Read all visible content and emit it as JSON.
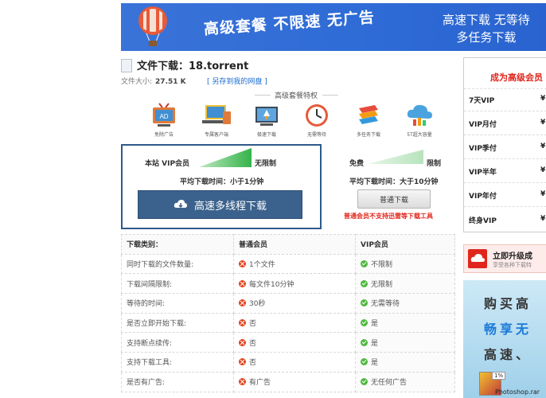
{
  "banner": {
    "promo_text": "高级套餐 不限速 无广告",
    "right_line1": "高速下载 无等待",
    "right_line2": "多任务下载"
  },
  "file": {
    "title": "文件下载：18.torrent",
    "size_label": "文件大小:",
    "size_value": "27.51 K",
    "save_link": "[ 另存到我的网盘 ]"
  },
  "features": {
    "title": "高级套餐特权",
    "items": [
      {
        "label": "免除广告",
        "icon": "tv-ad-icon"
      },
      {
        "label": "专属客户端",
        "icon": "devices-icon"
      },
      {
        "label": "极速下载",
        "icon": "rocket-icon"
      },
      {
        "label": "无需等待",
        "icon": "clock-icon"
      },
      {
        "label": "多任务下载",
        "icon": "stack-icon"
      },
      {
        "label": "5T超大容量",
        "icon": "cloud-storage-icon"
      }
    ]
  },
  "vip": {
    "left_label": "本站 VIP会员",
    "right_label": "无限制",
    "avg_speed": "平均下载时间：小于1分钟",
    "button_label": "高速多线程下载"
  },
  "free": {
    "left_label": "免费",
    "right_label": "限制",
    "avg_speed": "平均下载时间：大于10分钟",
    "button_label": "普通下载",
    "warning": "普通会员不支持迅雷等下载工具"
  },
  "comparison": {
    "headers": [
      "下载类别：",
      "普通会员",
      "VIP会员"
    ],
    "rows": [
      {
        "label": "同时下载的文件数量:",
        "normal": "1个文件",
        "vip": "不限制"
      },
      {
        "label": "下载间隔限制:",
        "normal": "每文件10分钟",
        "vip": "无限制"
      },
      {
        "label": "等待的时间:",
        "normal": "30秒",
        "vip": "无需等待"
      },
      {
        "label": "是否立即开始下载:",
        "normal": "否",
        "vip": "是"
      },
      {
        "label": "支持断点续传:",
        "normal": "否",
        "vip": "是"
      },
      {
        "label": "支持下载工具:",
        "normal": "否",
        "vip": "是"
      },
      {
        "label": "是否有广告:",
        "normal": "有广告",
        "vip": "无任何广告"
      }
    ]
  },
  "sidebar": {
    "title": "成为高级会员",
    "plans": [
      {
        "name": "7天VIP",
        "price": "¥"
      },
      {
        "name": "VIP月付",
        "price": "¥"
      },
      {
        "name": "VIP季付",
        "price": "¥"
      },
      {
        "name": "VIP半年",
        "price": "¥"
      },
      {
        "name": "VIP年付",
        "price": "¥"
      },
      {
        "name": "终身VIP",
        "price": "¥"
      }
    ],
    "upgrade_title": "立即升级成",
    "upgrade_sub": "享受各种下载特",
    "ad_lines": [
      "购买高",
      "畅享无",
      "高速、"
    ],
    "ad_badge": "1%",
    "ad_filename": "Photoshop.rar"
  },
  "colors": {
    "banner_blue": "#2e6bd6",
    "download_button": "#3b628d",
    "warning_red": "#e0261c",
    "ok_green": "#52b842",
    "no_red": "#e2431c"
  }
}
